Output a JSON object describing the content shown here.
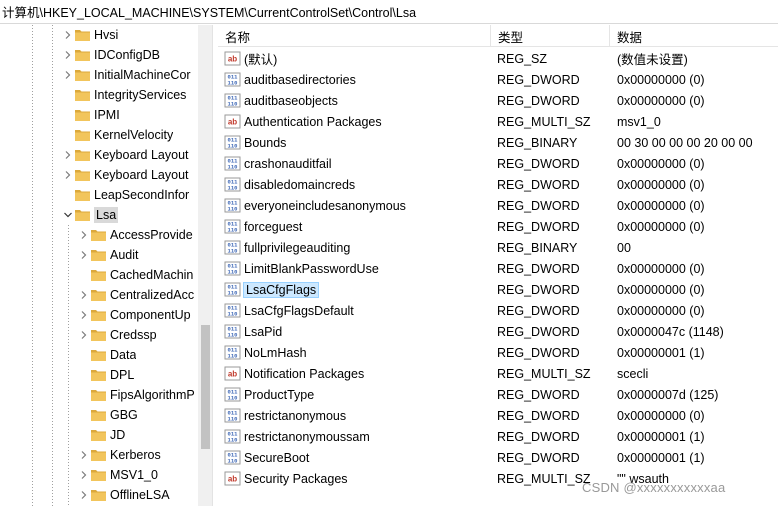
{
  "address": {
    "path": "计算机\\HKEY_LOCAL_MACHINE\\SYSTEM\\CurrentControlSet\\Control\\Lsa"
  },
  "tree": {
    "items": [
      {
        "label": "Hvsi",
        "level": 1,
        "expanded": false,
        "has_children": true
      },
      {
        "label": "IDConfigDB",
        "level": 1,
        "expanded": false,
        "has_children": true
      },
      {
        "label": "InitialMachineCor",
        "level": 1,
        "expanded": false,
        "has_children": true
      },
      {
        "label": "IntegrityServices",
        "level": 1,
        "expanded": false,
        "has_children": false
      },
      {
        "label": "IPMI",
        "level": 1,
        "expanded": false,
        "has_children": false
      },
      {
        "label": "KernelVelocity",
        "level": 1,
        "expanded": false,
        "has_children": false
      },
      {
        "label": "Keyboard Layout",
        "level": 1,
        "expanded": false,
        "has_children": true
      },
      {
        "label": "Keyboard Layout",
        "level": 1,
        "expanded": false,
        "has_children": true
      },
      {
        "label": "LeapSecondInfor",
        "level": 1,
        "expanded": false,
        "has_children": false
      },
      {
        "label": "Lsa",
        "level": 1,
        "expanded": true,
        "has_children": true,
        "selected": true
      },
      {
        "label": "AccessProvide",
        "level": 2,
        "expanded": false,
        "has_children": true
      },
      {
        "label": "Audit",
        "level": 2,
        "expanded": false,
        "has_children": true
      },
      {
        "label": "CachedMachin",
        "level": 2,
        "expanded": false,
        "has_children": false
      },
      {
        "label": "CentralizedAcc",
        "level": 2,
        "expanded": false,
        "has_children": true
      },
      {
        "label": "ComponentUp",
        "level": 2,
        "expanded": false,
        "has_children": true
      },
      {
        "label": "Credssp",
        "level": 2,
        "expanded": false,
        "has_children": true
      },
      {
        "label": "Data",
        "level": 2,
        "expanded": false,
        "has_children": false
      },
      {
        "label": "DPL",
        "level": 2,
        "expanded": false,
        "has_children": false
      },
      {
        "label": "FipsAlgorithmP",
        "level": 2,
        "expanded": false,
        "has_children": false
      },
      {
        "label": "GBG",
        "level": 2,
        "expanded": false,
        "has_children": false
      },
      {
        "label": "JD",
        "level": 2,
        "expanded": false,
        "has_children": false
      },
      {
        "label": "Kerberos",
        "level": 2,
        "expanded": false,
        "has_children": true
      },
      {
        "label": "MSV1_0",
        "level": 2,
        "expanded": false,
        "has_children": true
      },
      {
        "label": "OfflineLSA",
        "level": 2,
        "expanded": false,
        "has_children": true
      }
    ]
  },
  "list": {
    "columns": {
      "name": "名称",
      "type": "类型",
      "data": "数据"
    },
    "rows": [
      {
        "name": "(默认)",
        "type": "REG_SZ",
        "data": "(数值未设置)",
        "icon": "string-value-icon"
      },
      {
        "name": "auditbasedirectories",
        "type": "REG_DWORD",
        "data": "0x00000000 (0)",
        "icon": "binary-value-icon"
      },
      {
        "name": "auditbaseobjects",
        "type": "REG_DWORD",
        "data": "0x00000000 (0)",
        "icon": "binary-value-icon"
      },
      {
        "name": "Authentication Packages",
        "type": "REG_MULTI_SZ",
        "data": "msv1_0",
        "icon": "string-value-icon"
      },
      {
        "name": "Bounds",
        "type": "REG_BINARY",
        "data": "00 30 00 00 00 20 00 00",
        "icon": "binary-value-icon"
      },
      {
        "name": "crashonauditfail",
        "type": "REG_DWORD",
        "data": "0x00000000 (0)",
        "icon": "binary-value-icon"
      },
      {
        "name": "disabledomaincreds",
        "type": "REG_DWORD",
        "data": "0x00000000 (0)",
        "icon": "binary-value-icon"
      },
      {
        "name": "everyoneincludesanonymous",
        "type": "REG_DWORD",
        "data": "0x00000000 (0)",
        "icon": "binary-value-icon"
      },
      {
        "name": "forceguest",
        "type": "REG_DWORD",
        "data": "0x00000000 (0)",
        "icon": "binary-value-icon"
      },
      {
        "name": "fullprivilegeauditing",
        "type": "REG_BINARY",
        "data": "00",
        "icon": "binary-value-icon"
      },
      {
        "name": "LimitBlankPasswordUse",
        "type": "REG_DWORD",
        "data": "0x00000000 (0)",
        "icon": "binary-value-icon"
      },
      {
        "name": "LsaCfgFlags",
        "type": "REG_DWORD",
        "data": "0x00000000 (0)",
        "icon": "binary-value-icon",
        "selected": true
      },
      {
        "name": "LsaCfgFlagsDefault",
        "type": "REG_DWORD",
        "data": "0x00000000 (0)",
        "icon": "binary-value-icon"
      },
      {
        "name": "LsaPid",
        "type": "REG_DWORD",
        "data": "0x0000047c (1148)",
        "icon": "binary-value-icon"
      },
      {
        "name": "NoLmHash",
        "type": "REG_DWORD",
        "data": "0x00000001 (1)",
        "icon": "binary-value-icon"
      },
      {
        "name": "Notification Packages",
        "type": "REG_MULTI_SZ",
        "data": "scecli",
        "icon": "string-value-icon"
      },
      {
        "name": "ProductType",
        "type": "REG_DWORD",
        "data": "0x0000007d (125)",
        "icon": "binary-value-icon"
      },
      {
        "name": "restrictanonymous",
        "type": "REG_DWORD",
        "data": "0x00000000 (0)",
        "icon": "binary-value-icon"
      },
      {
        "name": "restrictanonymoussam",
        "type": "REG_DWORD",
        "data": "0x00000001 (1)",
        "icon": "binary-value-icon"
      },
      {
        "name": "SecureBoot",
        "type": "REG_DWORD",
        "data": "0x00000001 (1)",
        "icon": "binary-value-icon"
      },
      {
        "name": "Security Packages",
        "type": "REG_MULTI_SZ",
        "data": "\"\" wsauth",
        "icon": "string-value-icon"
      }
    ]
  },
  "watermark": {
    "text": "CSDN @xxxxxxxxxxxaa"
  },
  "colors": {
    "folder": "#f2c55c",
    "folder_dark": "#dca93b",
    "selection": "#cce8ff",
    "tree_selection": "#d9d9d9",
    "binary_icon": "#3c66b5",
    "string_icon": "#c0392b"
  }
}
